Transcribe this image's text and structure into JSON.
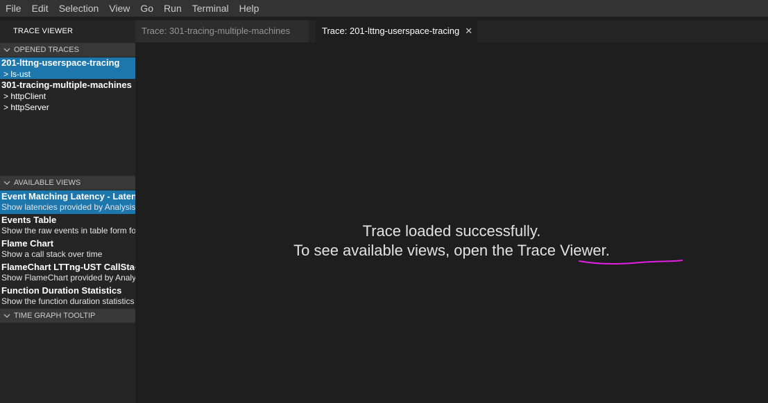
{
  "menu": [
    "File",
    "Edit",
    "Selection",
    "View",
    "Go",
    "Run",
    "Terminal",
    "Help"
  ],
  "sidebar": {
    "title": "TRACE VIEWER",
    "opened_traces": {
      "header": "OPENED TRACES",
      "items": [
        {
          "name": "201-lttng-userspace-tracing",
          "children": [
            "> ls-ust"
          ]
        },
        {
          "name": "301-tracing-multiple-machines",
          "children": [
            "> httpClient",
            "> httpServer"
          ]
        }
      ]
    },
    "available_views": {
      "header": "AVAILABLE VIEWS",
      "items": [
        {
          "name": "Event Matching Latency - Latency",
          "desc": "Show latencies provided by Analysis"
        },
        {
          "name": "Events Table",
          "desc": "Show the raw events in table form for"
        },
        {
          "name": "Flame Chart",
          "desc": "Show a call stack over time"
        },
        {
          "name": "FlameChart LTTng-UST CallStack",
          "desc": "Show FlameChart provided by Analysis"
        },
        {
          "name": "Function Duration Statistics",
          "desc": "Show the function duration statistics"
        }
      ]
    },
    "tooltip_section": {
      "header": "TIME GRAPH TOOLTIP"
    }
  },
  "tabs": [
    {
      "label": "Trace: 301-tracing-multiple-machines"
    },
    {
      "label": "Trace: 201-lttng-userspace-tracing",
      "close": "✕"
    }
  ],
  "editor": {
    "line1": "Trace loaded successfully.",
    "line2_prefix": "To see available views, open the ",
    "link_text": "Trace Viewer",
    "line2_suffix": "."
  },
  "colors": {
    "selection": "#1d76ac",
    "annotation": "#e61ee6"
  }
}
